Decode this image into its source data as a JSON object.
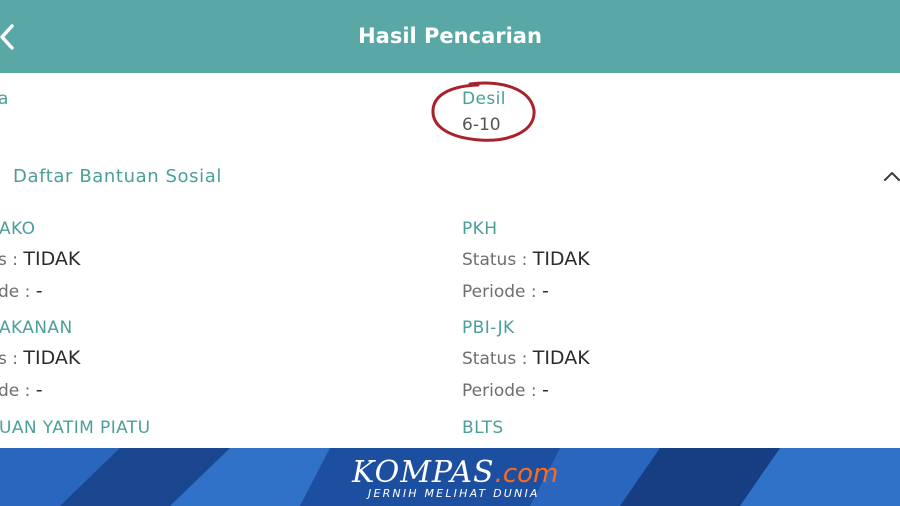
{
  "header": {
    "title": "Hasil Pencarian",
    "back_icon": "chevron-left-icon"
  },
  "summary": {
    "left_fragment": "a",
    "desil_label": "Desil",
    "desil_value": "6-10"
  },
  "section": {
    "title": "Daftar Bantuan Sosial",
    "toggle_icon": "chevron-up-icon"
  },
  "programs": [
    {
      "name": "AKO",
      "status_label": "s :",
      "status_value": "TIDAK",
      "periode_label": "de :",
      "periode_value": "-"
    },
    {
      "name": "PKH",
      "status_label": "Status :",
      "status_value": "TIDAK",
      "periode_label": "Periode :",
      "periode_value": "-"
    },
    {
      "name": "AKANAN",
      "status_label": "s :",
      "status_value": "TIDAK",
      "periode_label": "de :",
      "periode_value": "-"
    },
    {
      "name": "PBI-JK",
      "status_label": "Status :",
      "status_value": "TIDAK",
      "periode_label": "Periode :",
      "periode_value": "-"
    },
    {
      "name": "UAN YATIM PIATU"
    },
    {
      "name": "BLTS"
    }
  ],
  "watermark": {
    "brand": "KOMPAS",
    "brand_suffix": ".com",
    "tagline": "JERNIH MELIHAT DUNIA"
  },
  "colors": {
    "header_bg": "#59a8a5",
    "accent_teal": "#4a9f9b",
    "annotation": "#a8222b",
    "footer_bg": "#1d4fa1",
    "brand_orange": "#ff6a1a"
  }
}
